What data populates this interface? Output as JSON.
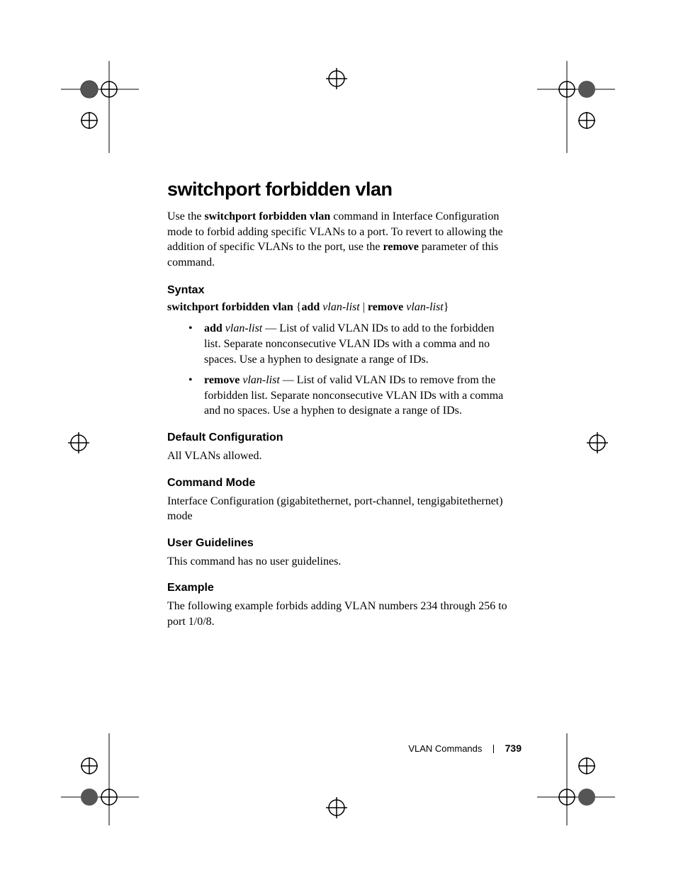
{
  "title": "switchport forbidden vlan",
  "intro": {
    "pre": "Use the ",
    "cmd": "switchport forbidden vlan",
    "mid1": " command in Interface Configuration mode to forbid adding specific VLANs to a port. To revert to allowing the addition of specific VLANs to the port, use the ",
    "param": "remove",
    "post": " parameter of this command."
  },
  "syntax": {
    "heading": "Syntax",
    "cmd": "switchport forbidden vlan",
    "brace_open": "{",
    "add": "add",
    "vlist1": "vlan-list",
    "pipe": " | ",
    "remove": "remove",
    "vlist2": "vlan-list",
    "brace_close": "}",
    "bullets": [
      {
        "kw": "add",
        "arg": "vlan-list",
        "dash": " — ",
        "desc": "List of valid VLAN IDs to add to the forbidden list. Separate nonconsecutive VLAN IDs with a comma and no spaces. Use a hyphen to designate a range of IDs."
      },
      {
        "kw": "remove",
        "arg": "vlan-list",
        "dash": " — ",
        "desc": "List of valid VLAN IDs to remove from the forbidden list. Separate nonconsecutive VLAN IDs with a comma and no spaces. Use a hyphen to designate a range of IDs."
      }
    ]
  },
  "default_cfg": {
    "heading": "Default Configuration",
    "body": "All VLANs allowed."
  },
  "cmd_mode": {
    "heading": "Command Mode",
    "body": "Interface Configuration (gigabitethernet, port-channel, tengigabitethernet) mode"
  },
  "guidelines": {
    "heading": "User Guidelines",
    "body": "This command has no user guidelines."
  },
  "example": {
    "heading": "Example",
    "body": "The following example forbids adding VLAN numbers 234 through 256 to port 1/0/8."
  },
  "footer": {
    "section": "VLAN Commands",
    "page": "739"
  }
}
